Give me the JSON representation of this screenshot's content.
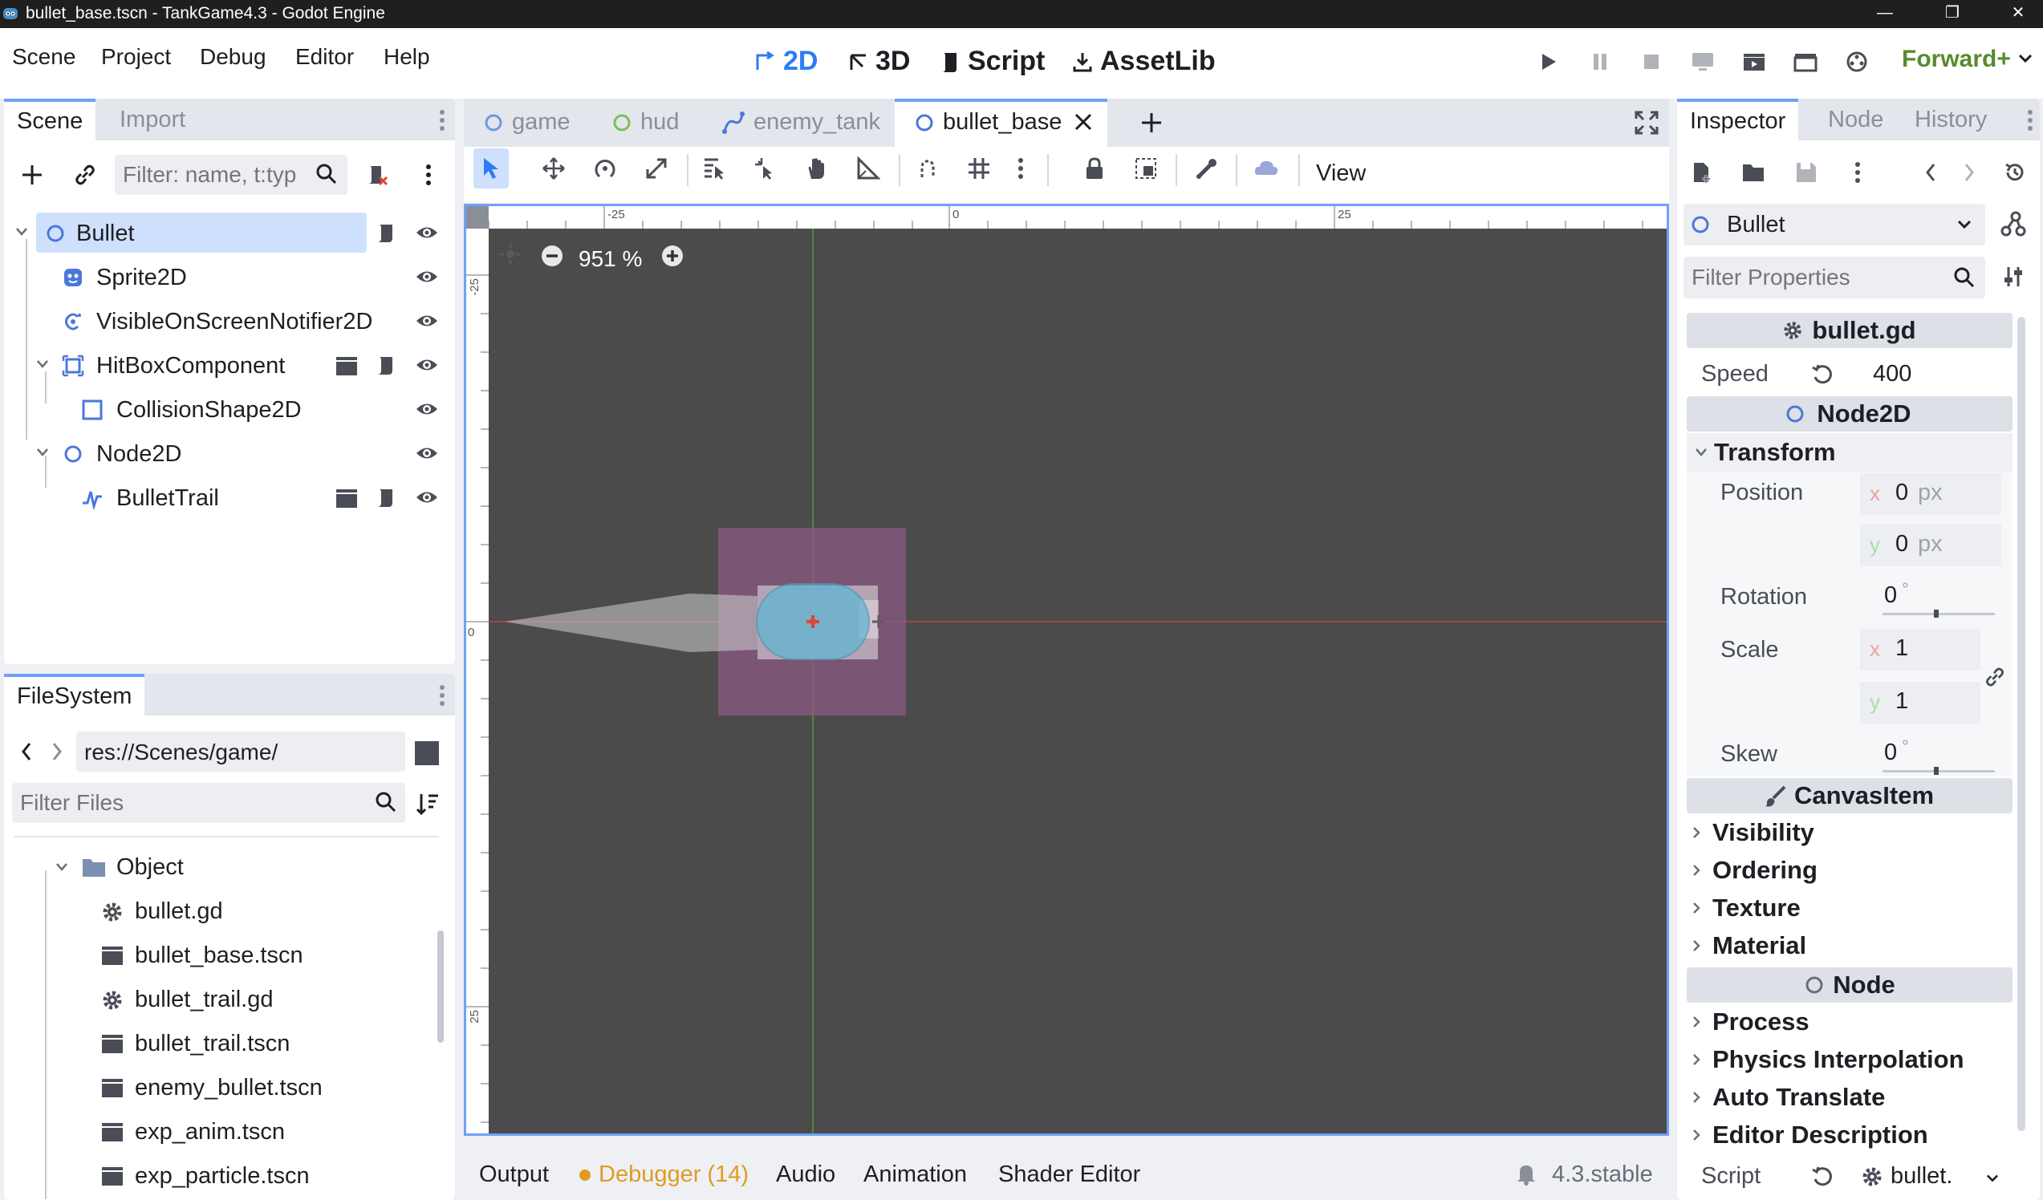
{
  "window": {
    "title": "bullet_base.tscn - TankGame4.3 - Godot Engine",
    "minimize": "—",
    "maximize": "❐",
    "close": "✕"
  },
  "menu": {
    "items": [
      "Scene",
      "Project",
      "Debug",
      "Editor",
      "Help"
    ]
  },
  "workspaces": {
    "w2d": "2D",
    "w3d": "3D",
    "script": "Script",
    "assetlib": "AssetLib"
  },
  "renderer": "Forward+",
  "scene_panel": {
    "tabs": [
      "Scene",
      "Import"
    ],
    "filter_placeholder": "Filter: name, t:typ",
    "tree": [
      {
        "label": "Bullet"
      },
      {
        "label": "Sprite2D"
      },
      {
        "label": "VisibleOnScreenNotifier2D"
      },
      {
        "label": "HitBoxComponent"
      },
      {
        "label": "CollisionShape2D"
      },
      {
        "label": "Node2D"
      },
      {
        "label": "BulletTrail"
      }
    ]
  },
  "filesystem": {
    "tab": "FileSystem",
    "path": "res://Scenes/game/",
    "filter_placeholder": "Filter Files",
    "items": [
      {
        "label": "Object"
      },
      {
        "label": "bullet.gd"
      },
      {
        "label": "bullet_base.tscn"
      },
      {
        "label": "bullet_trail.gd"
      },
      {
        "label": "bullet_trail.tscn"
      },
      {
        "label": "enemy_bullet.tscn"
      },
      {
        "label": "exp_anim.tscn"
      },
      {
        "label": "exp_particle.tscn"
      }
    ]
  },
  "editor_tabs": [
    {
      "label": "game"
    },
    {
      "label": "hud"
    },
    {
      "label": "enemy_tank"
    },
    {
      "label": "bullet_base"
    }
  ],
  "toolbar": {
    "view_label": "View"
  },
  "viewport": {
    "zoom": "951 %",
    "ruler": [
      "-25",
      "0",
      "25"
    ],
    "ruler_v": [
      "-25",
      "0",
      "25"
    ]
  },
  "bottom": {
    "tabs": [
      "Output",
      "Debugger (14)",
      "Audio",
      "Animation",
      "Shader Editor"
    ],
    "version": "4.3.stable",
    "debugger_color": "#e09b20"
  },
  "inspector": {
    "tabs": [
      "Inspector",
      "Node",
      "History"
    ],
    "object": "Bullet",
    "filter_placeholder": "Filter Properties",
    "script_section": "bullet.gd",
    "speed_label": "Speed",
    "speed_value": "400",
    "node2d_section": "Node2D",
    "transform_label": "Transform",
    "position_label": "Position",
    "pos_x": "0",
    "pos_y": "0",
    "unit_px": "px",
    "axis_x": "x",
    "axis_y": "y",
    "rotation_label": "Rotation",
    "rotation_value": "0",
    "degree": "°",
    "scale_label": "Scale",
    "scale_x": "1",
    "scale_y": "1",
    "skew_label": "Skew",
    "skew_value": "0",
    "canvasitem_section": "CanvasItem",
    "canvas_categories": [
      "Visibility",
      "Ordering",
      "Texture",
      "Material"
    ],
    "node_section": "Node",
    "node_categories": [
      "Process",
      "Physics Interpolation",
      "Auto Translate",
      "Editor Description"
    ],
    "script_label": "Script",
    "script_value": "bullet."
  }
}
